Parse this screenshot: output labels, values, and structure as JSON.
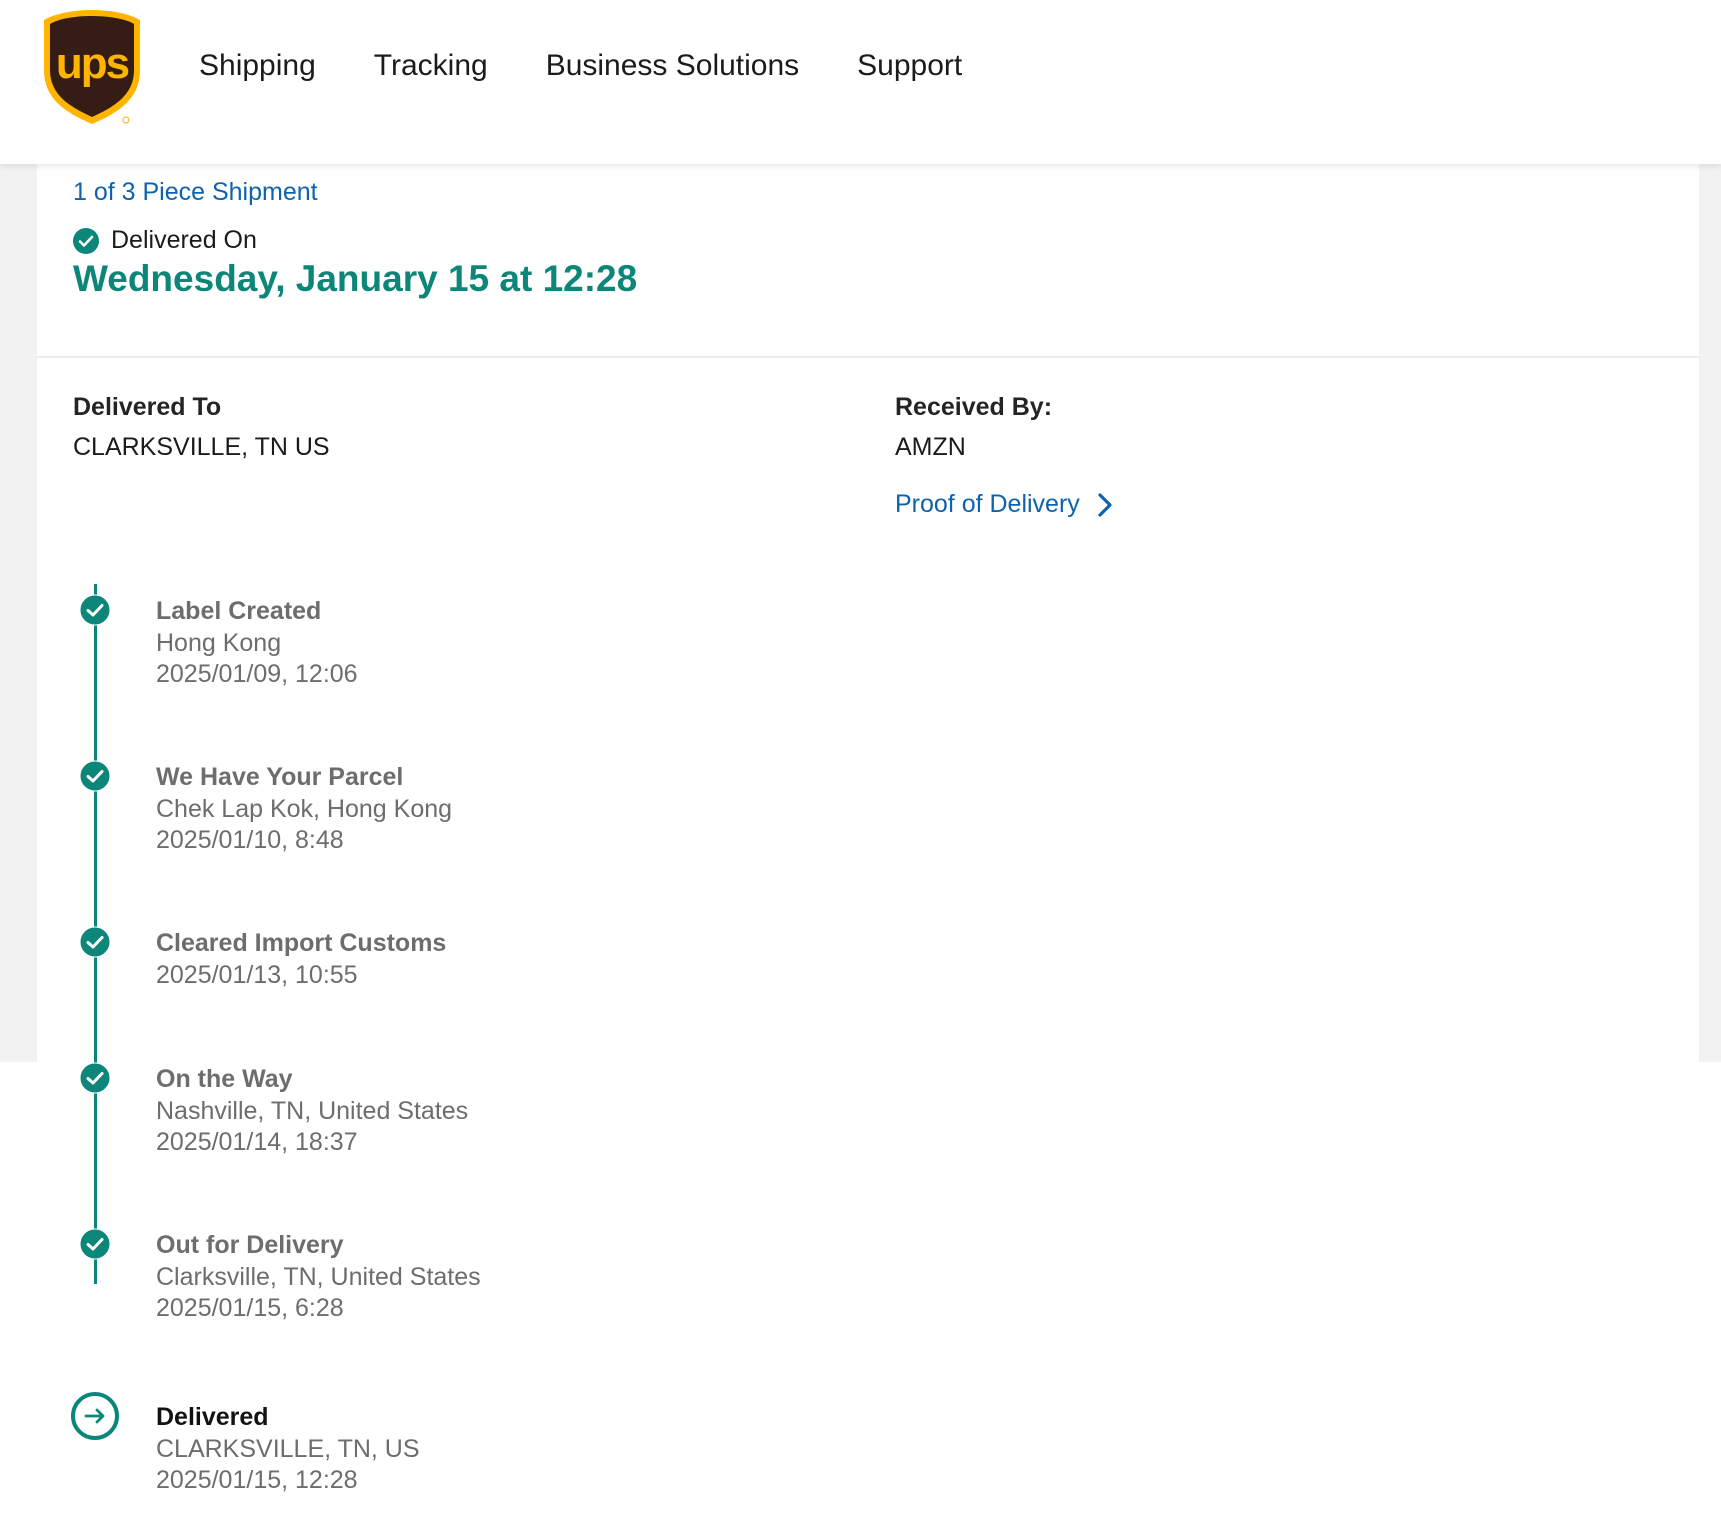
{
  "brand": {
    "logo_text": "ups",
    "logo_bg": "#351c15",
    "logo_accent": "#ffb500",
    "accent": "#0b8679",
    "link_color": "#0f62ad"
  },
  "nav": {
    "items": [
      "Shipping",
      "Tracking",
      "Business Solutions",
      "Support"
    ]
  },
  "shipment": {
    "piece_link": "1 of 3 Piece Shipment",
    "status_label": "Delivered On",
    "delivered_date": "Wednesday, January 15 at 12:28",
    "delivered_to_label": "Delivered To",
    "delivered_to_value": "CLARKSVILLE, TN US",
    "received_by_label": "Received By:",
    "received_by_value": "AMZN",
    "proof_link": "Proof of Delivery"
  },
  "events": [
    {
      "title": "Label Created",
      "location": "Hong Kong",
      "datetime": "2025/01/09, 12:06",
      "icon": "check-circle-icon"
    },
    {
      "title": "We Have Your Parcel",
      "location": "Chek Lap Kok, Hong Kong",
      "datetime": "2025/01/10, 8:48",
      "icon": "check-circle-icon"
    },
    {
      "title": "Cleared Import Customs",
      "location": "",
      "datetime": "2025/01/13, 10:55",
      "icon": "check-circle-icon"
    },
    {
      "title": "On the Way",
      "location": "Nashville, TN, United States",
      "datetime": "2025/01/14, 18:37",
      "icon": "check-circle-icon"
    },
    {
      "title": "Out for Delivery",
      "location": "Clarksville, TN, United States",
      "datetime": "2025/01/15, 6:28",
      "icon": "check-circle-icon"
    },
    {
      "title": "Delivered",
      "location": "CLARKSVILLE, TN, US",
      "datetime": "2025/01/15, 12:28",
      "icon": "arrow-right-circle-icon"
    }
  ]
}
